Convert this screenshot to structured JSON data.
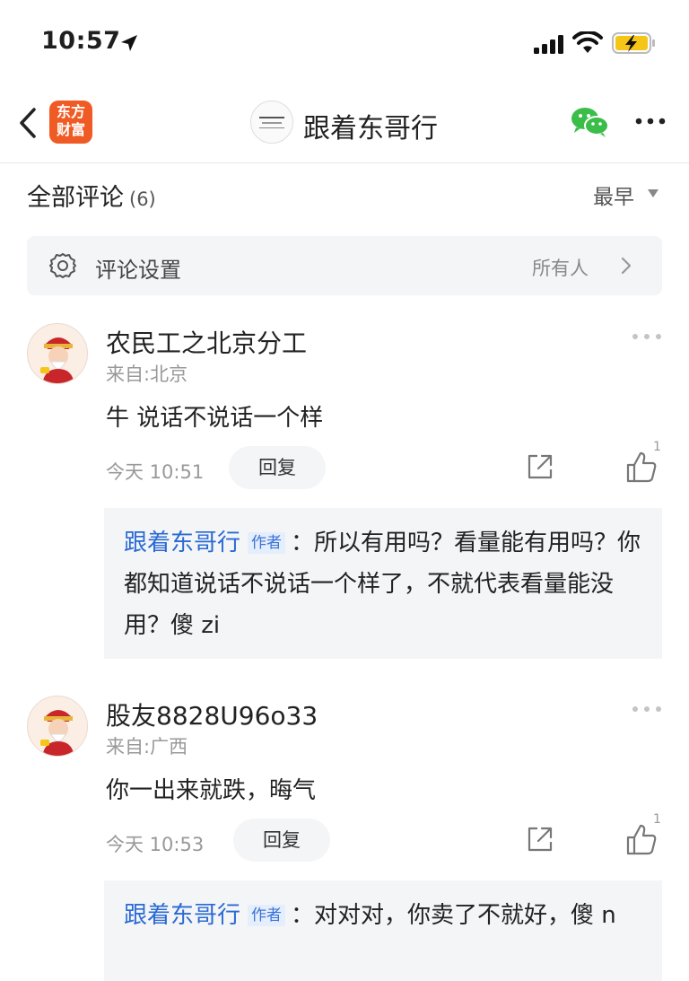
{
  "status_bar": {
    "time": "10:57",
    "icons": [
      "location-arrow-icon",
      "cellular-signal-icon",
      "wifi-icon",
      "battery-charging-icon"
    ],
    "battery_color": "#f5c518"
  },
  "nav": {
    "logo_line1": "东方",
    "logo_line2": "财富",
    "logo_color": "#f05a24",
    "title": "跟着东哥行"
  },
  "comments_header": {
    "title": "全部评论",
    "count": "(6)",
    "sort": "最早"
  },
  "settings": {
    "label": "评论设置",
    "value": "所有人"
  },
  "comments": [
    {
      "user": "农民工之北京分工",
      "location": "来自:北京",
      "text": "牛 说话不说话一个样",
      "time": "今天 10:51",
      "reply_label": "回复",
      "likes": "1",
      "reply": {
        "author": "跟着东哥行",
        "tag": "作者",
        "text": "：所以有用吗？看量能有用吗？你都知道说话不说话一个样了，不就代表看量能没用？傻 zi"
      }
    },
    {
      "user": "股友8828U96o33",
      "location": "来自:广西",
      "text": "你一出来就跌，晦气",
      "time": "今天 10:53",
      "reply_label": "回复",
      "likes": "1",
      "reply": {
        "author": "跟着东哥行",
        "tag": "作者",
        "text": "：对对对，你卖了不就好，傻 n"
      }
    }
  ],
  "colors": {
    "accent_blue": "#2a6ad3",
    "wechat_green": "#3bbd4a",
    "muted_gray": "#999999"
  }
}
